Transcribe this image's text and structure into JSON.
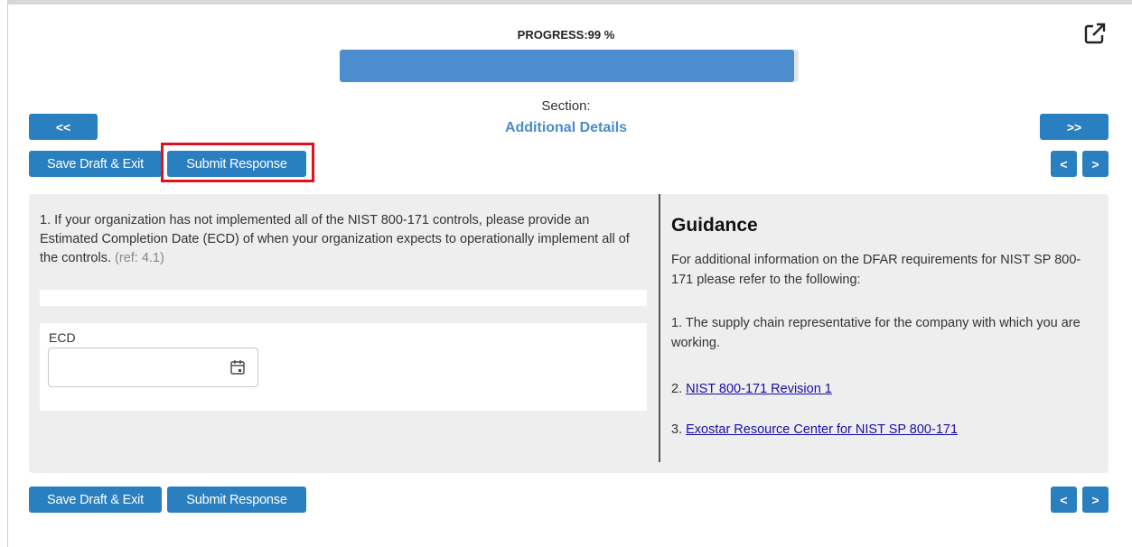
{
  "progress": {
    "label": "PROGRESS:99 %",
    "value_percent": 99
  },
  "section": {
    "label": "Section:",
    "name": "Additional Details"
  },
  "nav": {
    "first": "<<",
    "last": ">>",
    "prev": "<",
    "next": ">"
  },
  "actions": {
    "save_draft": "Save Draft & Exit",
    "submit": "Submit Response"
  },
  "question": {
    "text": "1. If your organization has not implemented all of the NIST 800-171 controls, please provide an Estimated Completion Date (ECD) of when your organization expects to operationally implement all of the controls.",
    "ref": "(ref: 4.1)"
  },
  "ecd": {
    "label": "ECD",
    "value": ""
  },
  "guidance": {
    "title": "Guidance",
    "intro": "For additional information on the DFAR requirements for NIST SP 800-171 please refer to the following:",
    "item1": "1. The supply chain representative for the company with which you are working.",
    "item2_prefix": "2. ",
    "item2_link": "NIST 800-171 Revision 1",
    "item3_prefix": "3. ",
    "item3_link": "Exostar Resource Center for NIST SP 800-171"
  },
  "icons": {
    "external": "external-link-icon",
    "calendar": "calendar-icon"
  },
  "colors": {
    "button": "#2a7fc1",
    "progress": "#4b8dcf",
    "section_name": "#4a8ccc",
    "highlight": "#e3111f"
  }
}
